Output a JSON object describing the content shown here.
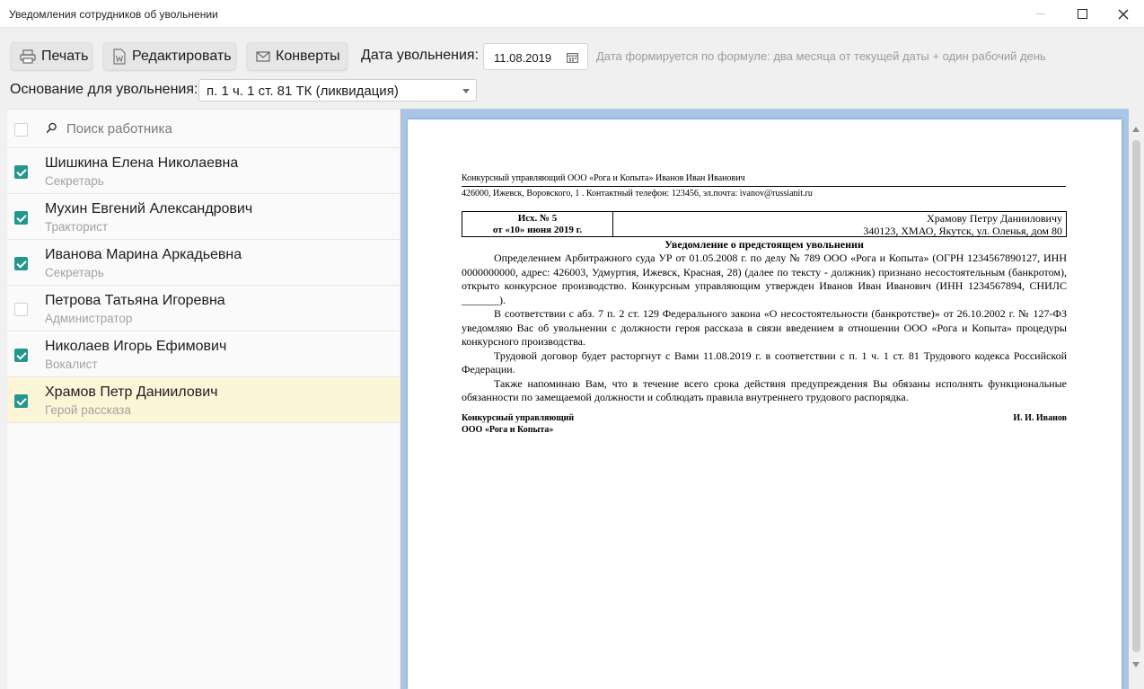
{
  "window": {
    "title": "Уведомления сотрудников об увольнении"
  },
  "toolbar": {
    "print_label": "Печать",
    "edit_label": "Редактировать",
    "envelopes_label": "Конверты",
    "date_label": "Дата увольнения:",
    "date_value": "11.08.2019",
    "date_hint": "Дата формируется по формуле: два месяца от текущей даты + один рабочий день",
    "reason_label": "Основание для увольнения:",
    "reason_value": "п. 1 ч. 1 ст. 81 ТК (ликвидация)"
  },
  "search": {
    "placeholder": "Поиск работника",
    "select_all_checked": false
  },
  "employees": [
    {
      "name": "Шишкина Елена Николаевна",
      "role": "Секретарь",
      "checked": true,
      "selected": false
    },
    {
      "name": "Мухин Евгений Александрович",
      "role": "Тракторист",
      "checked": true,
      "selected": false
    },
    {
      "name": "Иванова Марина Аркадьевна",
      "role": "Секретарь",
      "checked": true,
      "selected": false
    },
    {
      "name": "Петрова Татьяна Игоревна",
      "role": "Администратор",
      "checked": false,
      "selected": false
    },
    {
      "name": "Николаев Игорь Ефимович",
      "role": "Вокалист",
      "checked": true,
      "selected": false
    },
    {
      "name": "Храмов Петр Даниилович",
      "role": "Герой рассказа",
      "checked": true,
      "selected": true
    }
  ],
  "document": {
    "header_line1": "Конкурсный управляющий ООО «Рога и Копыта» Иванов Иван Иванович",
    "header_line2": "426000, Ижевск, Воровского, 1 . Контактный телефон: 123456, эл.почта: ivanov@russianit.ru",
    "out_number": "Исх. № 5",
    "out_date": "от «10» июня 2019 г.",
    "recipient_name": "Храмову Петру Данииловичу",
    "recipient_address": "340123, ХМАО, Якутск, ул. Оленья, дом 80",
    "title": "Уведомление о предстоящем увольнении",
    "paragraphs": [
      "Определением Арбитражного суда УР от 01.05.2008 г. по делу № 789 ООО «Рога и Копыта» (ОГРН 1234567890127, ИНН 0000000000, адрес: 426003, Удмуртия, Ижевск, Красная, 28) (далее по тексту - должник) признано несостоятельным (банкротом), открыто конкурсное производство. Конкурсным управляющим утвержден Иванов Иван Иванович (ИНН 1234567894, СНИЛС _______).",
      "В соответствии с абз. 7 п. 2 ст. 129 Федерального закона «О несостоятельности (банкротстве)» от 26.10.2002 г. № 127-ФЗ уведомляю Вас об увольнении с должности героя рассказа в связи введением в отношении ООО «Рога и Копыта» процедуры конкурсного производства.",
      "Трудовой договор будет расторгнут с Вами 11.08.2019 г. в соответствии с п. 1 ч. 1 ст. 81 Трудового кодекса Российской Федерации.",
      "Также напоминаю Вам, что в течение всего срока действия предупреждения Вы обязаны исполнять функциональные обязанности по замещаемой должности и соблюдать правила внутреннего трудового распорядка."
    ],
    "sign_position_line1": "Конкурсный управляющий",
    "sign_position_line2": "ООО «Рога и Копыта»",
    "sign_name": "И. И. Иванов"
  },
  "colors": {
    "checkbox_accent": "#23978c",
    "selected_row": "#fdf5d8",
    "preview_background": "#a9c6e6"
  },
  "icons": [
    "printer-icon",
    "word-icon",
    "envelope-icon",
    "calendar-icon",
    "search-icon",
    "chevron-down-icon",
    "minimize-icon",
    "maximize-icon",
    "close-icon"
  ]
}
